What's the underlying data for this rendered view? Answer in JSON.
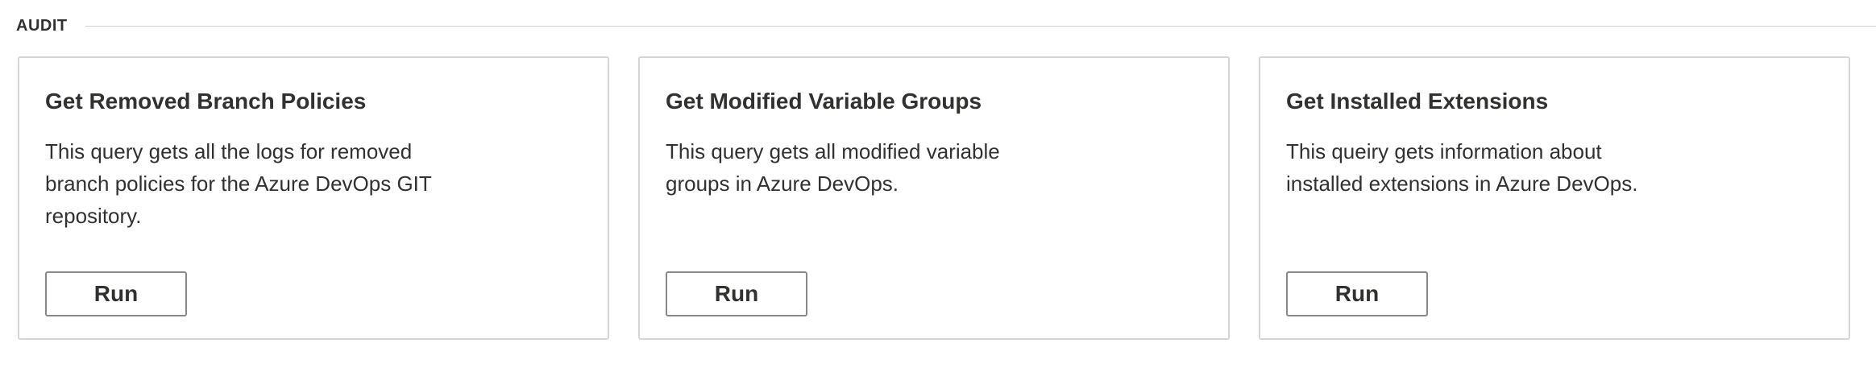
{
  "section": {
    "title": "AUDIT"
  },
  "cards": [
    {
      "title": "Get Removed Branch Policies",
      "description": "This query gets all the logs for removed branch policies for the Azure DevOps GIT repository.",
      "button_label": "Run"
    },
    {
      "title": "Get Modified Variable Groups",
      "description": "This query gets all modified variable groups in Azure DevOps.",
      "button_label": "Run"
    },
    {
      "title": "Get Installed Extensions",
      "description": "This queiry gets information about installed extensions in Azure DevOps.",
      "button_label": "Run"
    }
  ]
}
